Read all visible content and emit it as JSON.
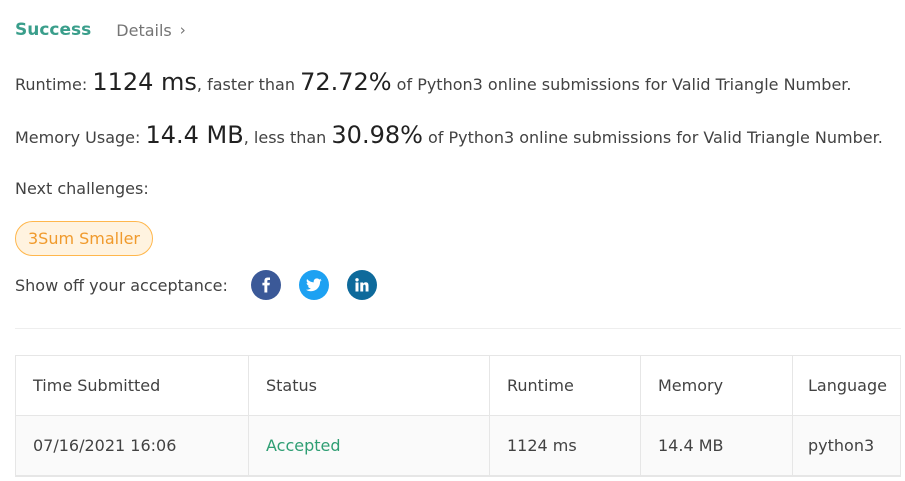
{
  "header": {
    "status": "Success",
    "details_label": "Details",
    "details_chevron": "›"
  },
  "runtime": {
    "label": "Runtime: ",
    "value": "1124 ms",
    "mid": ", faster than ",
    "percent": "72.72%",
    "suffix": " of Python3 online submissions for Valid Triangle Number."
  },
  "memory": {
    "label": "Memory Usage: ",
    "value": "14.4 MB",
    "mid": ", less than ",
    "percent": "30.98%",
    "suffix": " of Python3 online submissions for Valid Triangle Number."
  },
  "next_challenges": {
    "label": "Next challenges:",
    "items": [
      "3Sum Smaller"
    ]
  },
  "share": {
    "label": "Show off your acceptance:",
    "icons": [
      "facebook-icon",
      "twitter-icon",
      "linkedin-icon"
    ]
  },
  "table": {
    "headers": [
      "Time Submitted",
      "Status",
      "Runtime",
      "Memory",
      "Language"
    ],
    "rows": [
      [
        "07/16/2021 16:06",
        "Accepted",
        "1124 ms",
        "14.4 MB",
        "python3"
      ]
    ]
  },
  "colors": {
    "success": "#3a9e8b",
    "accepted": "#2e9e73",
    "pill_bg": "#fff3e0",
    "pill_border": "#ffb74d"
  }
}
